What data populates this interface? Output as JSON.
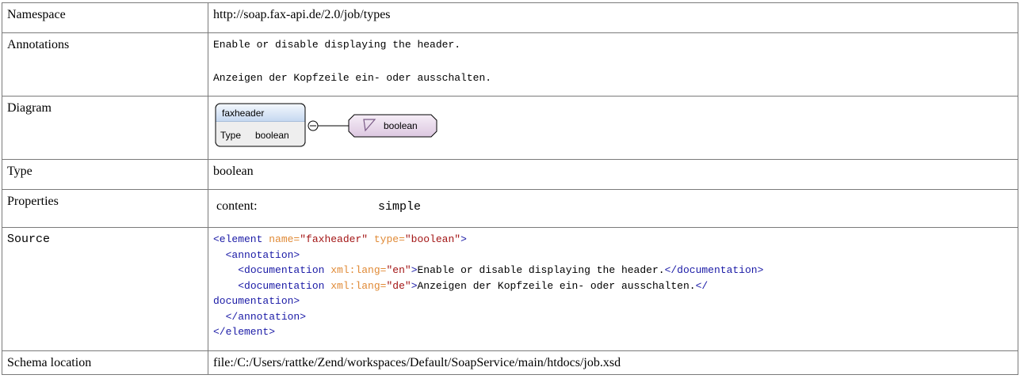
{
  "rows": {
    "namespace": {
      "label": "Namespace",
      "value": "http://soap.fax-api.de/2.0/job/types"
    },
    "annotations": {
      "label": "Annotations",
      "lines": [
        "Enable or disable displaying the header.",
        "Anzeigen der Kopfzeile ein- oder ausschalten."
      ]
    },
    "diagram": {
      "label": "Diagram",
      "element_name": "faxheader",
      "type_label": "Type",
      "type_value": "boolean",
      "simple_type": "boolean"
    },
    "type": {
      "label": "Type",
      "value": "boolean"
    },
    "properties": {
      "label": "Properties",
      "key": "content:",
      "value": "simple"
    },
    "source": {
      "label": "Source",
      "lines": [
        [
          "tag:<element ",
          "attr:name=",
          "val:\"faxheader\"",
          "attr: type=",
          "val:\"boolean\"",
          "tag:>"
        ],
        [
          "txt:  ",
          "tag:<annotation>"
        ],
        [
          "txt:    ",
          "tag:<documentation ",
          "attr:xml:lang=",
          "val:\"en\"",
          "tag:>",
          "txt:Enable or disable displaying the header.",
          "tag:</documentation>"
        ],
        [
          "txt:    ",
          "tag:<documentation ",
          "attr:xml:lang=",
          "val:\"de\"",
          "tag:>",
          "txt:Anzeigen der Kopfzeile ein- oder ausschalten.",
          "tag:</"
        ],
        [
          "tag:documentation>"
        ],
        [
          "txt:  ",
          "tag:</annotation>"
        ],
        [
          "tag:</element>"
        ]
      ]
    },
    "schema_location": {
      "label": "Schema location",
      "value": "file:/C:/Users/rattke/Zend/workspaces/Default/SoapService/main/htdocs/job.xsd"
    }
  },
  "colors": {
    "tag": "#1a1aa6",
    "attr": "#e08a36",
    "val": "#a31515",
    "border": "#7a7a7a"
  },
  "icons": {
    "element_box": "element-box-icon",
    "connector": "sequence-connector-icon",
    "simple_type": "simple-type-icon"
  }
}
